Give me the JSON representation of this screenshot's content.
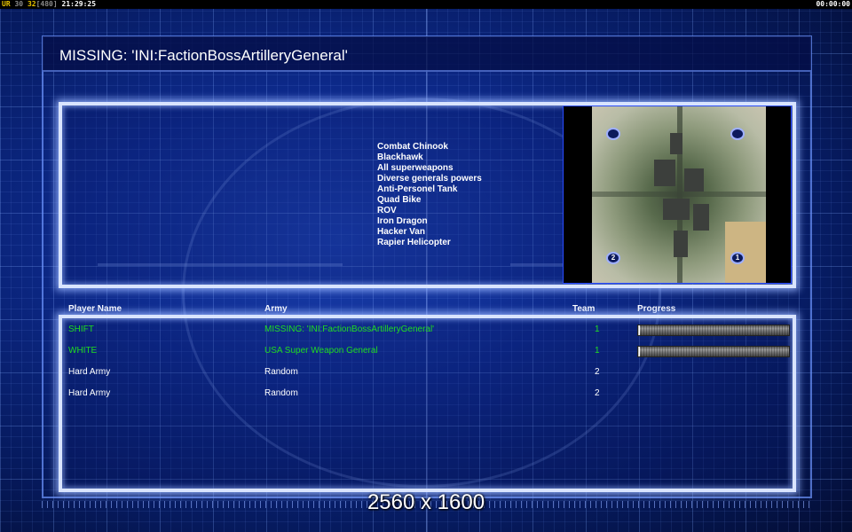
{
  "status_bar": {
    "ur_label": "UR",
    "stat1": "30",
    "stat2": "32",
    "stat3": "[480]",
    "clock": "21:29:25",
    "timer": "00:00:00"
  },
  "title": "MISSING: 'INI:FactionBossArtilleryGeneral'",
  "units": [
    "Combat Chinook",
    "Blackhawk",
    "All superweapons",
    "Diverse generals powers",
    "Anti-Personel Tank",
    "Quad Bike",
    "ROV",
    "Iron Dragon",
    "Hacker Van",
    "Rapier Helicopter"
  ],
  "map": {
    "spawns": [
      "",
      "",
      "2",
      "1"
    ]
  },
  "table": {
    "headers": {
      "player": "Player Name",
      "army": "Army",
      "team": "Team",
      "progress": "Progress"
    },
    "rows": [
      {
        "player": "SHIFT",
        "army": "MISSING: 'INI:FactionBossArtilleryGeneral'",
        "team": "1",
        "progress": 0.01
      },
      {
        "player": "WHITE",
        "army": "USA Super Weapon General",
        "team": "1",
        "progress": 0.01
      },
      {
        "player": "Hard Army",
        "army": "Random",
        "team": "2"
      },
      {
        "player": "Hard Army",
        "army": "Random",
        "team": "2"
      }
    ]
  },
  "resolution": "2560 x 1600",
  "colors": {
    "human_player": "#1fdc1f",
    "ai_player": "#ffffff",
    "frame_glow": "#d9e4ff"
  }
}
